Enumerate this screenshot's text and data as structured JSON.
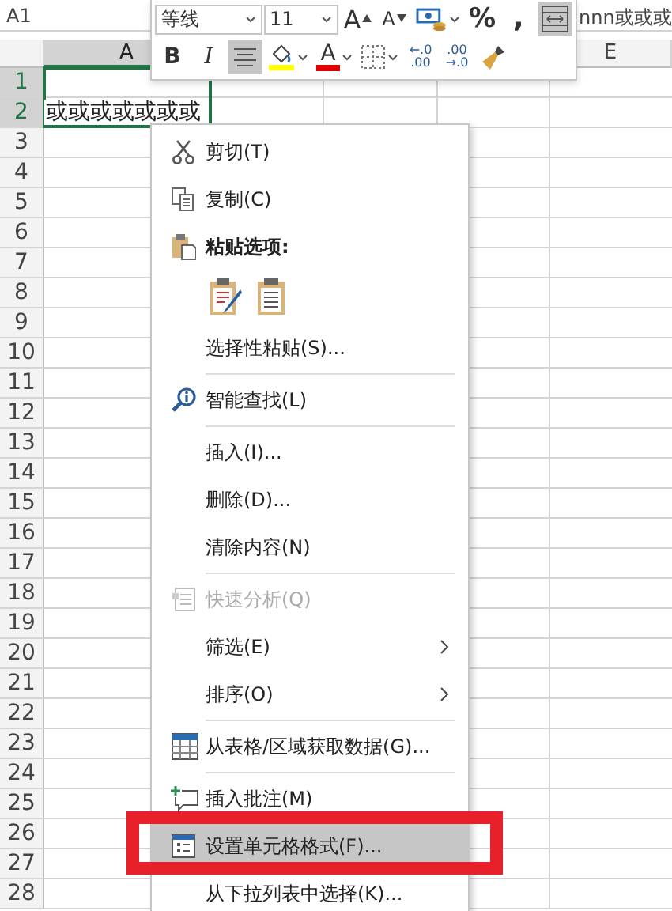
{
  "sheet": {
    "name_box": "A1",
    "formula": "nnn或或或",
    "columns": [
      {
        "label": "A",
        "selected": true
      },
      {
        "label": "E",
        "selected": false
      }
    ],
    "rows": [
      {
        "label": "1",
        "selected": true
      },
      {
        "label": "2",
        "selected": true,
        "column_a": "或或或或或或或"
      },
      {
        "label": "3",
        "selected": false
      },
      {
        "label": "4",
        "selected": false
      },
      {
        "label": "5",
        "selected": false
      },
      {
        "label": "6",
        "selected": false
      },
      {
        "label": "7",
        "selected": false
      },
      {
        "label": "8",
        "selected": false
      },
      {
        "label": "9",
        "selected": false
      },
      {
        "label": "10",
        "selected": false
      },
      {
        "label": "11",
        "selected": false
      },
      {
        "label": "12",
        "selected": false
      },
      {
        "label": "13",
        "selected": false
      },
      {
        "label": "14",
        "selected": false
      },
      {
        "label": "15",
        "selected": false
      },
      {
        "label": "16",
        "selected": false
      },
      {
        "label": "17",
        "selected": false
      },
      {
        "label": "18",
        "selected": false
      },
      {
        "label": "19",
        "selected": false
      },
      {
        "label": "20",
        "selected": false
      },
      {
        "label": "21",
        "selected": false
      },
      {
        "label": "22",
        "selected": false
      },
      {
        "label": "23",
        "selected": false
      },
      {
        "label": "24",
        "selected": false
      },
      {
        "label": "25",
        "selected": false
      },
      {
        "label": "26",
        "selected": false
      },
      {
        "label": "27",
        "selected": false
      },
      {
        "label": "28",
        "selected": false
      }
    ]
  },
  "mini_toolbar": {
    "row_1": [
      {
        "kind": "font-box",
        "value": "等线"
      },
      {
        "kind": "size-box",
        "value": "11"
      },
      {
        "kind": "grow-font",
        "label": "A",
        "selected": false
      },
      {
        "kind": "shrink-font",
        "label": "A",
        "selected": false
      },
      {
        "kind": "currency",
        "selected": false
      },
      {
        "kind": "text",
        "label": "%",
        "selected": false
      },
      {
        "kind": "text",
        "label": ",",
        "selected": false
      },
      {
        "kind": "wrap",
        "selected": true
      }
    ],
    "row_2": [
      {
        "kind": "bold",
        "label": "B",
        "selected": false
      },
      {
        "kind": "italic",
        "label": "I",
        "selected": false
      },
      {
        "kind": "align-center",
        "selected": true
      },
      {
        "kind": "fill-color",
        "selected": false
      },
      {
        "kind": "font-color",
        "label": "A",
        "selected": false
      },
      {
        "kind": "borders",
        "selected": false
      },
      {
        "kind": "decimals",
        "lines": [
          "←.0",
          ".00"
        ],
        "selected": false
      },
      {
        "kind": "decimals",
        "lines": [
          ".00",
          "→.0"
        ],
        "selected": false
      },
      {
        "kind": "painter",
        "selected": false
      }
    ]
  },
  "menu": {
    "items": [
      {
        "kind": "item",
        "label": "剪切(T)",
        "disabled": false,
        "selected": false,
        "submenu": false
      },
      {
        "kind": "item",
        "label": "复制(C)",
        "disabled": false,
        "selected": false,
        "submenu": false
      },
      {
        "kind": "header",
        "label": "粘贴选项:"
      },
      {
        "kind": "paste-options"
      },
      {
        "kind": "item",
        "label": "选择性粘贴(S)...",
        "disabled": false,
        "selected": false,
        "submenu": false
      },
      {
        "kind": "separator"
      },
      {
        "kind": "item",
        "label": "智能查找(L)",
        "disabled": false,
        "selected": false,
        "submenu": false
      },
      {
        "kind": "separator"
      },
      {
        "kind": "item",
        "label": "插入(I)...",
        "disabled": false,
        "selected": false,
        "submenu": false
      },
      {
        "kind": "item",
        "label": "删除(D)...",
        "disabled": false,
        "selected": false,
        "submenu": false
      },
      {
        "kind": "item",
        "label": "清除内容(N)",
        "disabled": false,
        "selected": false,
        "submenu": false
      },
      {
        "kind": "separator"
      },
      {
        "kind": "item",
        "label": "快速分析(Q)",
        "disabled": true,
        "selected": false,
        "submenu": false
      },
      {
        "kind": "item",
        "label": "筛选(E)",
        "disabled": false,
        "selected": false,
        "submenu": true
      },
      {
        "kind": "item",
        "label": "排序(O)",
        "disabled": false,
        "selected": false,
        "submenu": true
      },
      {
        "kind": "separator"
      },
      {
        "kind": "item",
        "label": "从表格/区域获取数据(G)...",
        "disabled": false,
        "selected": false,
        "submenu": false
      },
      {
        "kind": "separator"
      },
      {
        "kind": "item",
        "label": "插入批注(M)",
        "disabled": false,
        "selected": false,
        "submenu": false
      },
      {
        "kind": "item",
        "label": "设置单元格格式(F)...",
        "disabled": false,
        "selected": true,
        "submenu": false
      },
      {
        "kind": "item",
        "label": "从下拉列表中选择(K)...",
        "disabled": false,
        "selected": false,
        "submenu": false
      }
    ]
  },
  "annotation": {
    "kind": "frame"
  }
}
